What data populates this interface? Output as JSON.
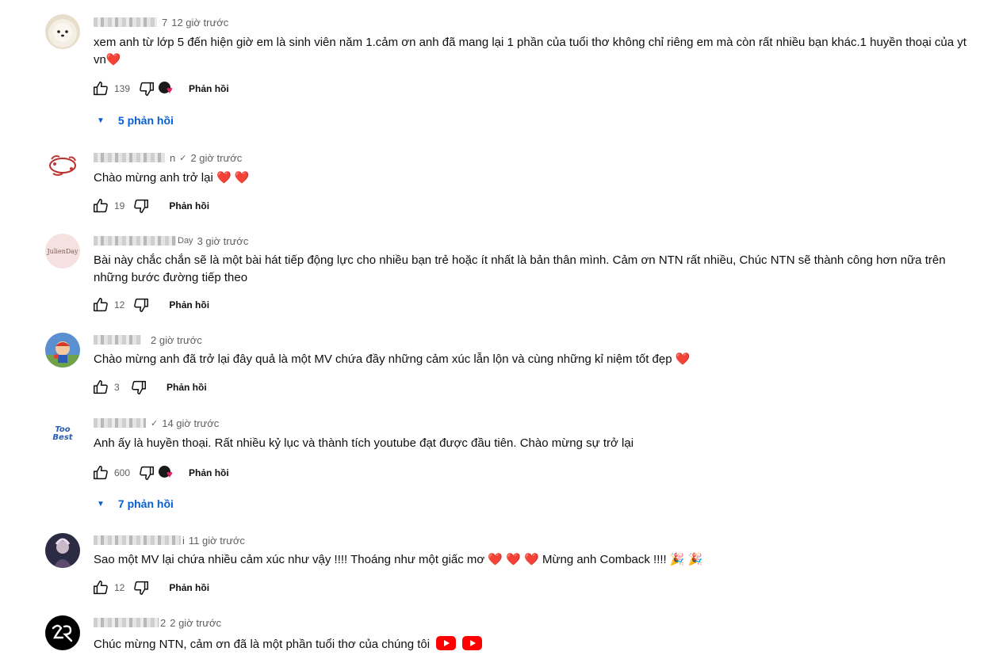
{
  "comments": [
    {
      "handle_tail": "7",
      "time": "12 giờ trước",
      "text": "xem anh từ lớp 5 đến hiện giờ em là sinh viên năm 1.cảm ơn anh đã mang lại 1 phần của tuổi thơ không chỉ riêng em mà còn rất nhiều bạn khác.1 huyền thoại của yt vn",
      "emoji": "❤️",
      "likes": "139",
      "reply_label": "Phản hồi",
      "replies_label": "5 phản hồi"
    },
    {
      "handle_tail": "n",
      "verified": "✓",
      "time": "2 giờ trước",
      "text": "Chào mừng anh trở lại",
      "emoji": "❤️ ❤️",
      "likes": "19",
      "reply_label": "Phản hồi"
    },
    {
      "handle_tail": "Day",
      "time": "3 giờ trước",
      "text": "Bài này chắc chắn sẽ là một bài hát tiếp động lực cho nhiều bạn trẻ hoặc ít nhất là bản thân mình. Cảm ơn NTN rất nhiều, Chúc NTN sẽ thành công hơn nữa trên những bước đường tiếp theo",
      "likes": "12",
      "reply_label": "Phản hồi",
      "avatar_text": "JulienDay"
    },
    {
      "handle_tail": "",
      "time": "2 giờ trước",
      "text": "Chào mừng anh đã trở lại đây quả là một MV chứa đầy những cảm xúc lẫn lộn và cùng những kỉ niệm tốt đẹp",
      "emoji": "❤️",
      "likes": "3",
      "reply_label": "Phản hồi"
    },
    {
      "handle_tail": "",
      "verified": "✓",
      "time": "14 giờ trước",
      "text": "Anh ấy là huyền thoại. Rất nhiều kỷ lục và thành tích youtube đạt được đầu tiên. Chào mừng sự trở lại",
      "likes": "600",
      "reply_label": "Phản hồi",
      "replies_label": "7 phản hồi",
      "avatar_text": "Too Best"
    },
    {
      "handle_tail": "i",
      "time": "11 giờ trước",
      "text": "Sao một MV lại chứa nhiều cảm xúc như vậy !!!! Thoáng như một giấc mơ ❤️ ❤️ ❤️ Mừng anh Comback !!!!",
      "emoji": "🎉 🎉",
      "likes": "12",
      "reply_label": "Phản hồi"
    },
    {
      "handle_tail": "2",
      "time": "2 giờ trước",
      "text": "Chúc mừng NTN, cảm ơn đã là một phần tuổi thơ của chúng tôi"
    }
  ],
  "colors": {
    "link": "#065fd4",
    "meta": "#606060",
    "heart": "#e0245e",
    "youtube_red": "#ff0000"
  },
  "icons": {
    "like": "thumbs-up-icon",
    "dislike": "thumbs-down-icon",
    "expand": "triangle-down-icon"
  }
}
